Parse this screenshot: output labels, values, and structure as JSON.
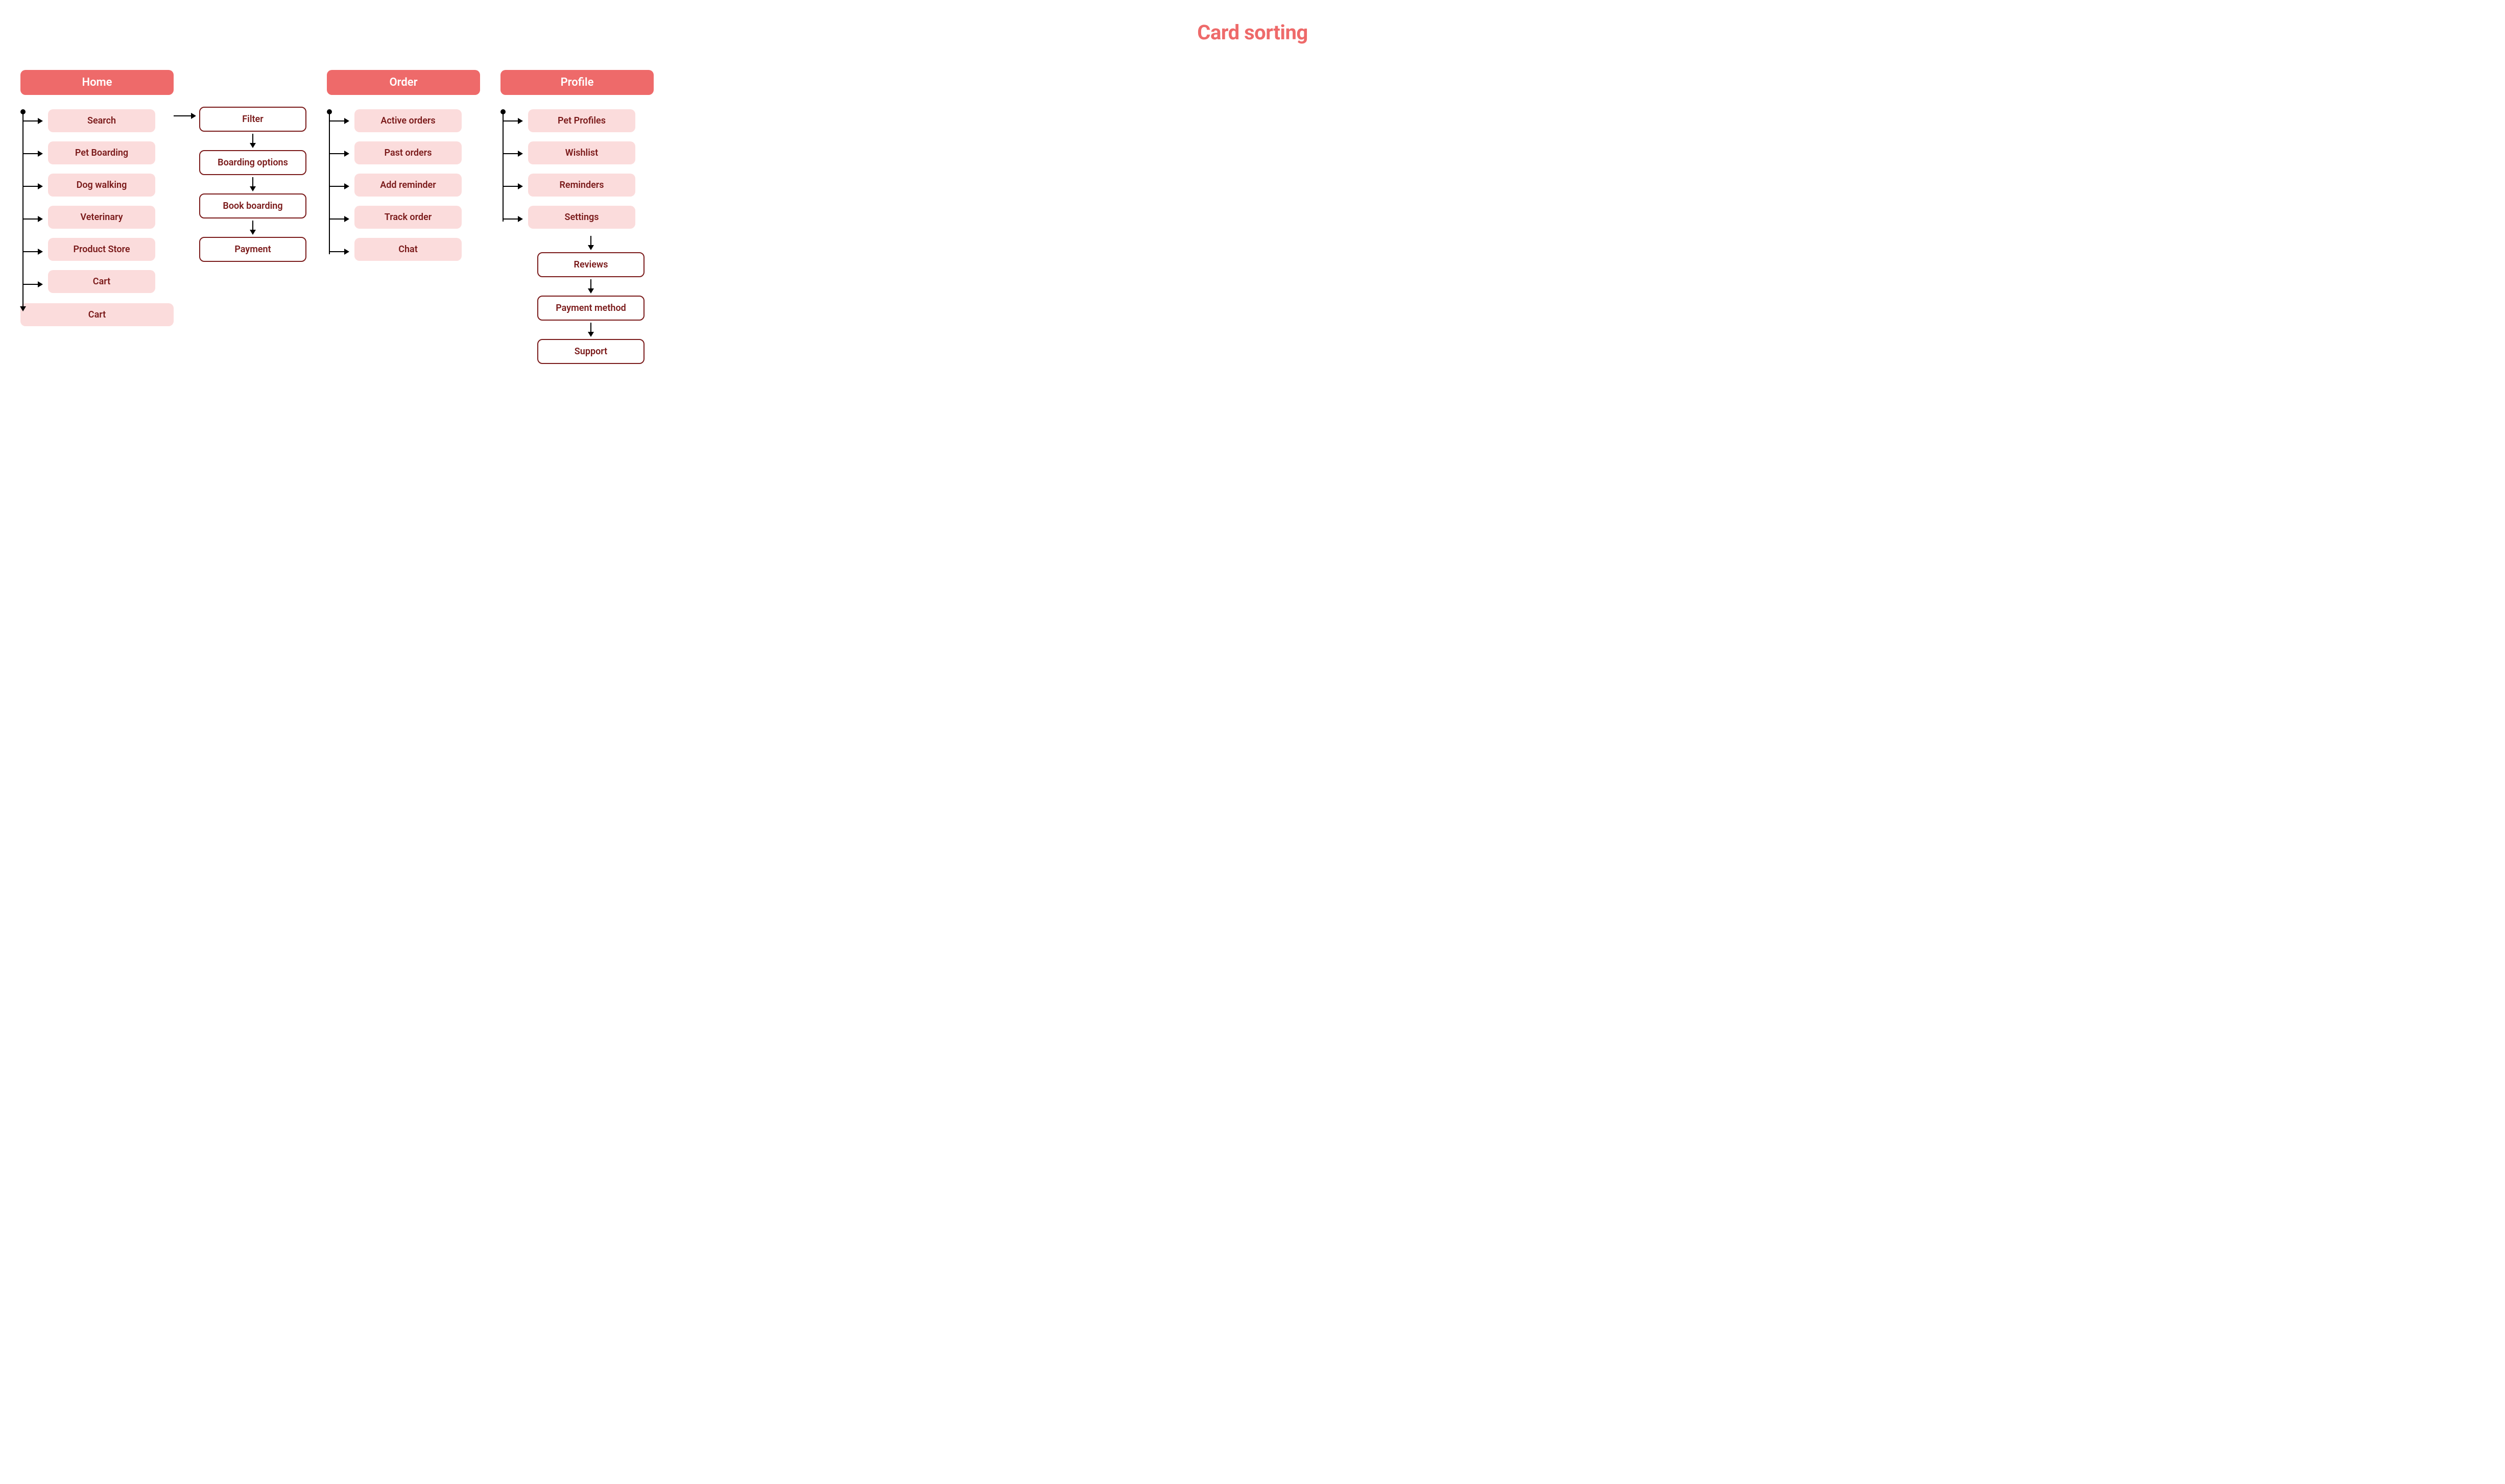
{
  "title": "Card sorting",
  "groups": {
    "home": {
      "header": "Home",
      "items": [
        "Search",
        "Pet Boarding",
        "Dog walking",
        "Veterinary",
        "Product Store",
        "Cart"
      ],
      "end": "Cart",
      "side_chain": [
        "Filter",
        "Boarding options",
        "Book boarding",
        "Payment"
      ]
    },
    "order": {
      "header": "Order",
      "items": [
        "Active orders",
        "Past orders",
        "Add reminder",
        "Track order",
        "Chat"
      ]
    },
    "profile": {
      "header": "Profile",
      "items": [
        "Pet Profiles",
        "Wishlist",
        "Reminders",
        "Settings"
      ],
      "sub_chain": [
        "Reviews",
        "Payment method",
        "Support"
      ]
    }
  }
}
